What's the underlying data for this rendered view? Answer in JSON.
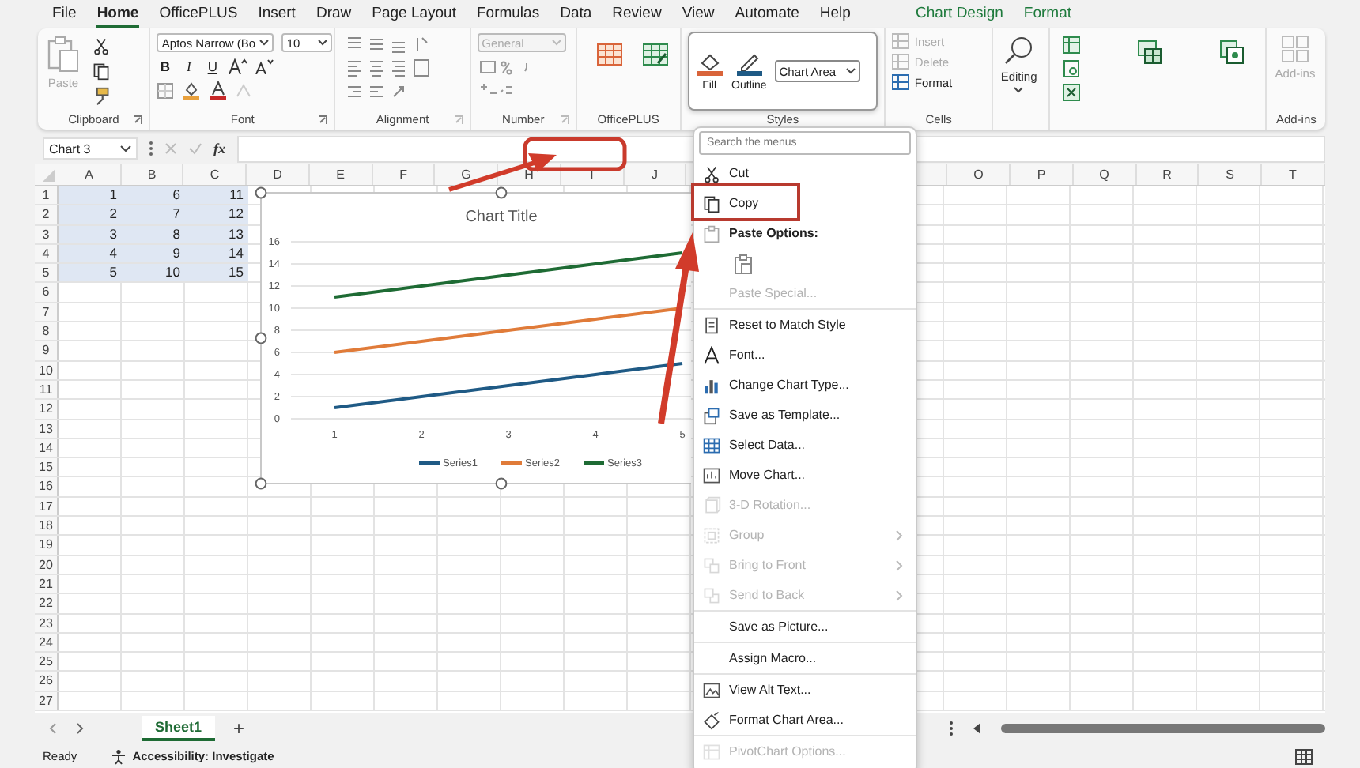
{
  "tabs": [
    {
      "label": "File",
      "selected": false,
      "kind": "main"
    },
    {
      "label": "Home",
      "selected": true,
      "kind": "main"
    },
    {
      "label": "OfficePLUS",
      "selected": false,
      "kind": "main"
    },
    {
      "label": "Insert",
      "selected": false,
      "kind": "main"
    },
    {
      "label": "Draw",
      "selected": false,
      "kind": "main"
    },
    {
      "label": "Page Layout",
      "selected": false,
      "kind": "main"
    },
    {
      "label": "Formulas",
      "selected": false,
      "kind": "main"
    },
    {
      "label": "Data",
      "selected": false,
      "kind": "main"
    },
    {
      "label": "Review",
      "selected": false,
      "kind": "main"
    },
    {
      "label": "View",
      "selected": false,
      "kind": "main"
    },
    {
      "label": "Automate",
      "selected": false,
      "kind": "main"
    },
    {
      "label": "Help",
      "selected": false,
      "kind": "main"
    },
    {
      "label": "Chart Design",
      "selected": false,
      "kind": "contextual"
    },
    {
      "label": "Format",
      "selected": false,
      "kind": "contextual"
    }
  ],
  "ribbon": {
    "clipboard": {
      "label": "Clipboard",
      "paste": "Paste",
      "paste_disabled": true
    },
    "font": {
      "label": "Font",
      "font_name": "Aptos Narrow (Bo",
      "font_size": "10",
      "styles": [
        "B",
        "I",
        "U"
      ]
    },
    "alignment": {
      "label": "Alignment"
    },
    "number": {
      "label": "Number",
      "format": "General",
      "disabled": true
    },
    "officeplus": {
      "label": "OfficePLUS"
    },
    "styles": {
      "label": "Styles",
      "fill": "Fill",
      "outline": "Outline",
      "element": "Chart Area"
    },
    "cells": {
      "label": "Cells",
      "buttons": [
        {
          "label": "Insert",
          "disabled": true
        },
        {
          "label": "Delete",
          "disabled": true
        },
        {
          "label": "Format",
          "disabled": false
        }
      ]
    },
    "editing": {
      "label": "Editing"
    },
    "addins": {
      "button": "Add-ins",
      "label": "Add-ins",
      "disabled": true
    }
  },
  "formula_bar": {
    "name_box": "Chart 3",
    "fx": "fx"
  },
  "columns_left": [
    "A",
    "B",
    "C",
    "D",
    "E",
    "F",
    "G",
    "H",
    "I",
    "J"
  ],
  "columns_right": [
    "O",
    "P",
    "Q",
    "R",
    "S",
    "T"
  ],
  "rows": [
    {
      "number": "1",
      "cells": [
        {
          "value": "1",
          "selected": true
        },
        {
          "value": "6",
          "selected": true
        },
        {
          "value": "11",
          "selected": true
        }
      ]
    },
    {
      "number": "2",
      "cells": [
        {
          "value": "2",
          "selected": true
        },
        {
          "value": "7",
          "selected": true
        },
        {
          "value": "12",
          "selected": true
        }
      ]
    },
    {
      "number": "3",
      "cells": [
        {
          "value": "3",
          "selected": true
        },
        {
          "value": "8",
          "selected": true
        },
        {
          "value": "13",
          "selected": true
        }
      ]
    },
    {
      "number": "4",
      "cells": [
        {
          "value": "4",
          "selected": true
        },
        {
          "value": "9",
          "selected": true
        },
        {
          "value": "14",
          "selected": true
        }
      ]
    },
    {
      "number": "5",
      "cells": [
        {
          "value": "5",
          "selected": true
        },
        {
          "value": "10",
          "selected": true
        },
        {
          "value": "15",
          "selected": true
        }
      ]
    },
    {
      "number": "6",
      "cells": []
    },
    {
      "number": "7",
      "cells": []
    },
    {
      "number": "8",
      "cells": []
    },
    {
      "number": "9",
      "cells": []
    },
    {
      "number": "10",
      "cells": []
    },
    {
      "number": "11",
      "cells": []
    },
    {
      "number": "12",
      "cells": []
    },
    {
      "number": "13",
      "cells": []
    },
    {
      "number": "14",
      "cells": []
    },
    {
      "number": "15",
      "cells": []
    },
    {
      "number": "16",
      "cells": []
    },
    {
      "number": "17",
      "cells": []
    },
    {
      "number": "18",
      "cells": []
    },
    {
      "number": "19",
      "cells": []
    },
    {
      "number": "20",
      "cells": []
    },
    {
      "number": "21",
      "cells": []
    },
    {
      "number": "22",
      "cells": []
    },
    {
      "number": "23",
      "cells": []
    },
    {
      "number": "24",
      "cells": []
    },
    {
      "number": "25",
      "cells": []
    },
    {
      "number": "26",
      "cells": []
    },
    {
      "number": "27",
      "cells": []
    }
  ],
  "chart": {
    "chart_data": {
      "type": "line",
      "title": "Chart Title",
      "categories": [
        "1",
        "2",
        "3",
        "4",
        "5"
      ],
      "series": [
        {
          "name": "Series1",
          "color": "#1f5a85",
          "values": [
            1,
            2,
            3,
            4,
            5
          ]
        },
        {
          "name": "Series2",
          "color": "#e07b39",
          "values": [
            6,
            7,
            8,
            9,
            10
          ]
        },
        {
          "name": "Series3",
          "color": "#1e6b34",
          "values": [
            11,
            12,
            13,
            14,
            15
          ]
        }
      ],
      "ylim": [
        0,
        16
      ],
      "yticks": [
        0,
        2,
        4,
        6,
        8,
        10,
        12,
        14,
        16
      ],
      "grid": true,
      "legend": "bottom"
    }
  },
  "context_menu": {
    "search_placeholder": "Search the menus",
    "items": [
      {
        "kind": "item",
        "label": "Cut",
        "disabled": false,
        "submenu": false,
        "divider_before": false
      },
      {
        "kind": "item",
        "label": "Copy",
        "disabled": false,
        "submenu": false,
        "divider_before": false
      },
      {
        "kind": "header",
        "label": "Paste Options:"
      },
      {
        "kind": "icon-row"
      },
      {
        "kind": "item",
        "label": "Paste Special...",
        "disabled": true,
        "submenu": false,
        "divider_before": false
      },
      {
        "kind": "item",
        "label": "Reset to Match Style",
        "disabled": false,
        "submenu": false,
        "divider_before": true
      },
      {
        "kind": "item",
        "label": "Font...",
        "disabled": false,
        "submenu": false,
        "divider_before": false
      },
      {
        "kind": "item",
        "label": "Change Chart Type...",
        "disabled": false,
        "submenu": false,
        "divider_before": false
      },
      {
        "kind": "item",
        "label": "Save as Template...",
        "disabled": false,
        "submenu": false,
        "divider_before": false
      },
      {
        "kind": "item",
        "label": "Select Data...",
        "disabled": false,
        "submenu": false,
        "divider_before": false
      },
      {
        "kind": "item",
        "label": "Move Chart...",
        "disabled": false,
        "submenu": false,
        "divider_before": false
      },
      {
        "kind": "item",
        "label": "3-D Rotation...",
        "disabled": true,
        "submenu": false,
        "divider_before": false
      },
      {
        "kind": "item",
        "label": "Group",
        "disabled": true,
        "submenu": true,
        "divider_before": false
      },
      {
        "kind": "item",
        "label": "Bring to Front",
        "disabled": true,
        "submenu": true,
        "divider_before": false
      },
      {
        "kind": "item",
        "label": "Send to Back",
        "disabled": true,
        "submenu": true,
        "divider_before": false
      },
      {
        "kind": "item",
        "label": "Save as Picture...",
        "disabled": false,
        "submenu": false,
        "divider_before": true
      },
      {
        "kind": "item",
        "label": "Assign Macro...",
        "disabled": false,
        "submenu": false,
        "divider_before": true
      },
      {
        "kind": "item",
        "label": "View Alt Text...",
        "disabled": false,
        "submenu": false,
        "divider_before": true
      },
      {
        "kind": "item",
        "label": "Format Chart Area...",
        "disabled": false,
        "submenu": false,
        "divider_before": false
      },
      {
        "kind": "item",
        "label": "PivotChart Options...",
        "disabled": true,
        "submenu": false,
        "divider_before": true
      }
    ]
  },
  "sheet_tabs": [
    {
      "label": "Sheet1",
      "selected": true
    }
  ],
  "add_sheet": "+",
  "status_bar": {
    "ready": "Ready",
    "accessibility": "Accessibility: Investigate"
  }
}
